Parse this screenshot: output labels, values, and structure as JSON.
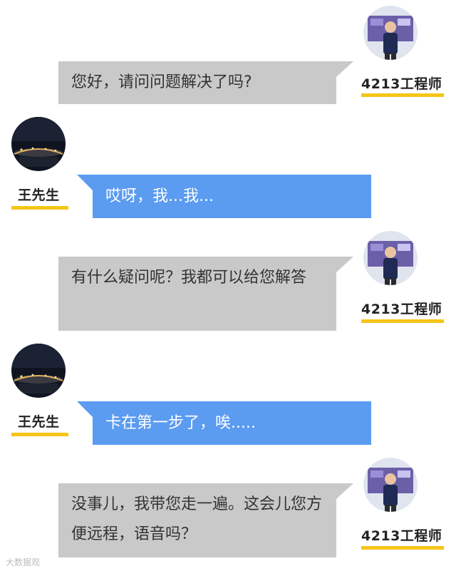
{
  "engineer": {
    "name": "4213工程师"
  },
  "customer": {
    "name": "王先生"
  },
  "messages": [
    {
      "from": "engineer",
      "text": "您好，请问问题解决了吗?"
    },
    {
      "from": "customer",
      "text": "哎呀，我...我..."
    },
    {
      "from": "engineer",
      "text": "有什么疑问呢？我都可以给您解答"
    },
    {
      "from": "customer",
      "text": "卡在第一步了，唉....."
    },
    {
      "from": "engineer",
      "text": "没事儿，我带您走一遍。这会儿您方便远程，语音吗？"
    }
  ],
  "watermark": "大数据观",
  "colors": {
    "engineer_bubble": "#c9c9c9",
    "customer_bubble": "#5b9bf0",
    "name_underline": "#f5c518"
  }
}
